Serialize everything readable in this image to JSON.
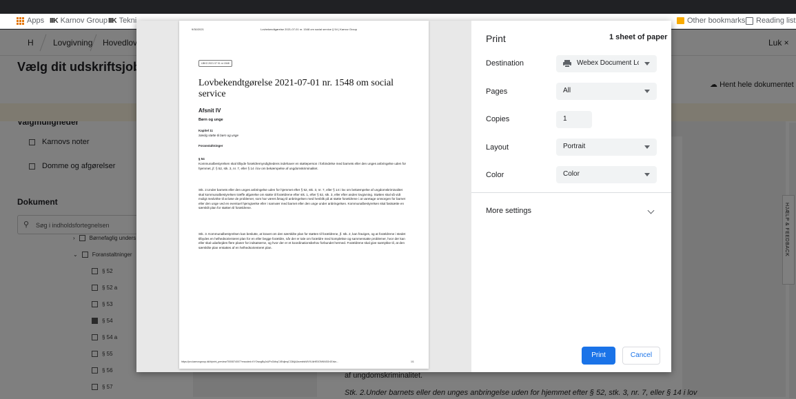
{
  "bookmarks": {
    "apps": "Apps",
    "karnov": "Karnov Group",
    "teknik": "Tekni",
    "other": "Other bookmarks",
    "reading": "Reading list"
  },
  "page": {
    "crumbs": [
      "H",
      "Lovgivning",
      "Hovedlove"
    ],
    "close": "Luk ×",
    "panel_title": "Vælg dit udskriftsjob",
    "options_heading": "Valgmuligheder",
    "option1": "Karnovs noter",
    "option2": "Domme og afgørelser",
    "doc_heading": "Dokument",
    "search_placeholder": "Søg i indholdsfortegnelsen",
    "fetch_doc": "Hent hele dokumentet",
    "tree": [
      "Børnefaglig unders",
      "Foranstaltninger",
      "§ 52",
      "§ 52 a",
      "§ 53",
      "§ 54",
      "§ 54 a",
      "§ 55",
      "§ 56",
      "§ 57"
    ],
    "doc_line1": "af ungdomskriminalitet.",
    "doc_line2": "Stk. 2.Under barnets eller den unges anbringelse uden for hjemmet efter § 52, stk. 3, nr. 7, eller § 14 i lov",
    "feedback": "HJÆLP & FEEDBACK"
  },
  "sheet": {
    "date": "9/30/2021",
    "header_title": "Lovbekendtgørelse 2021-07-01 nr. 1548 om social service § 54 | Karnov Group",
    "badge": "LBKG 2021 07 01 nr 1548",
    "title": "Lovbekendtgørelse 2021-07-01 nr. 1548 om social service",
    "afsnit": "Afsnit IV",
    "born": "Børn og unge",
    "kapitel": "Kapitel 11",
    "kapitel_sub": "Særlig støtte til børn og unge",
    "foranst": "Foranstaltninger",
    "para_num": "§ 54",
    "p1": "Kommunalbestyrelsen skal tilbyde forældremyndighedens indehaver en støtteperson i forbindelse med barnets eller den unges anbringelse uden for hjemmet, jf. § 52, stk. 3, nr. 7, eller § 14 i lov om bekæmpelse af ungdomskriminalitet.",
    "p2": "Stk. 2.Under barnets eller den unges anbringelse uden for hjemmet efter § 52, stk. 3, nr. 7, eller § 14 i lov om bekæmpelse af ungdomskriminalitet skal kommunalbestyrelsen træffe afgørelse om støtte til forældrene efter stk. 1, efter § 52, stk. 3, eller efter anden lovgivning. Støtten skal så vidt muligt medvirke til at løse de problemer, som har været årsag til anbringelsen med henblik på at støtte forældrene i at varetage omsorgen for barnet eller den unge ved en eventuel hjemgivelse eller i samvær med barnet eller den unge under anbringelsen. Kommunalbestyrelsen skal fastsætte en særskilt plan for støtten til forældrene.",
    "p3": "Stk. 3. Kommunalbestyrelsen kan beslutte, at kravet om den særskilte plan for støtten til forældrene, jf. stk. 2, kan fraviges, og at forældrene i stedet tilbydes en helhedsorienteret plan for en eller begge forældre, når der er tale om forældre med komplekse og sammensatte problemer, hvor der kan eller skal udarbejdes flere planer for indsatserne, og hvor der er et koordinationsbehov forbundet hermed. Forældrene skal give samtykke til, at den særskilte plan erstattes af en helhedsorienteret plan.",
    "footer_url": "https://pro.karnovgroup.dk/b/print_preview/7000874007?encoded=KYOwogBqJsUPoGdhqC4EsljmqCC8AjAAsrmlnkWVXUkHE0ONNN3Or1Edvc...",
    "footer_page": "1/1"
  },
  "print": {
    "title": "Print",
    "sheets": "1 sheet of paper",
    "destination_label": "Destination",
    "destination_value": "Webex Document Loa",
    "pages_label": "Pages",
    "pages_value": "All",
    "copies_label": "Copies",
    "copies_value": "1",
    "layout_label": "Layout",
    "layout_value": "Portrait",
    "color_label": "Color",
    "color_value": "Color",
    "more_settings": "More settings",
    "print_btn": "Print",
    "cancel_btn": "Cancel"
  }
}
